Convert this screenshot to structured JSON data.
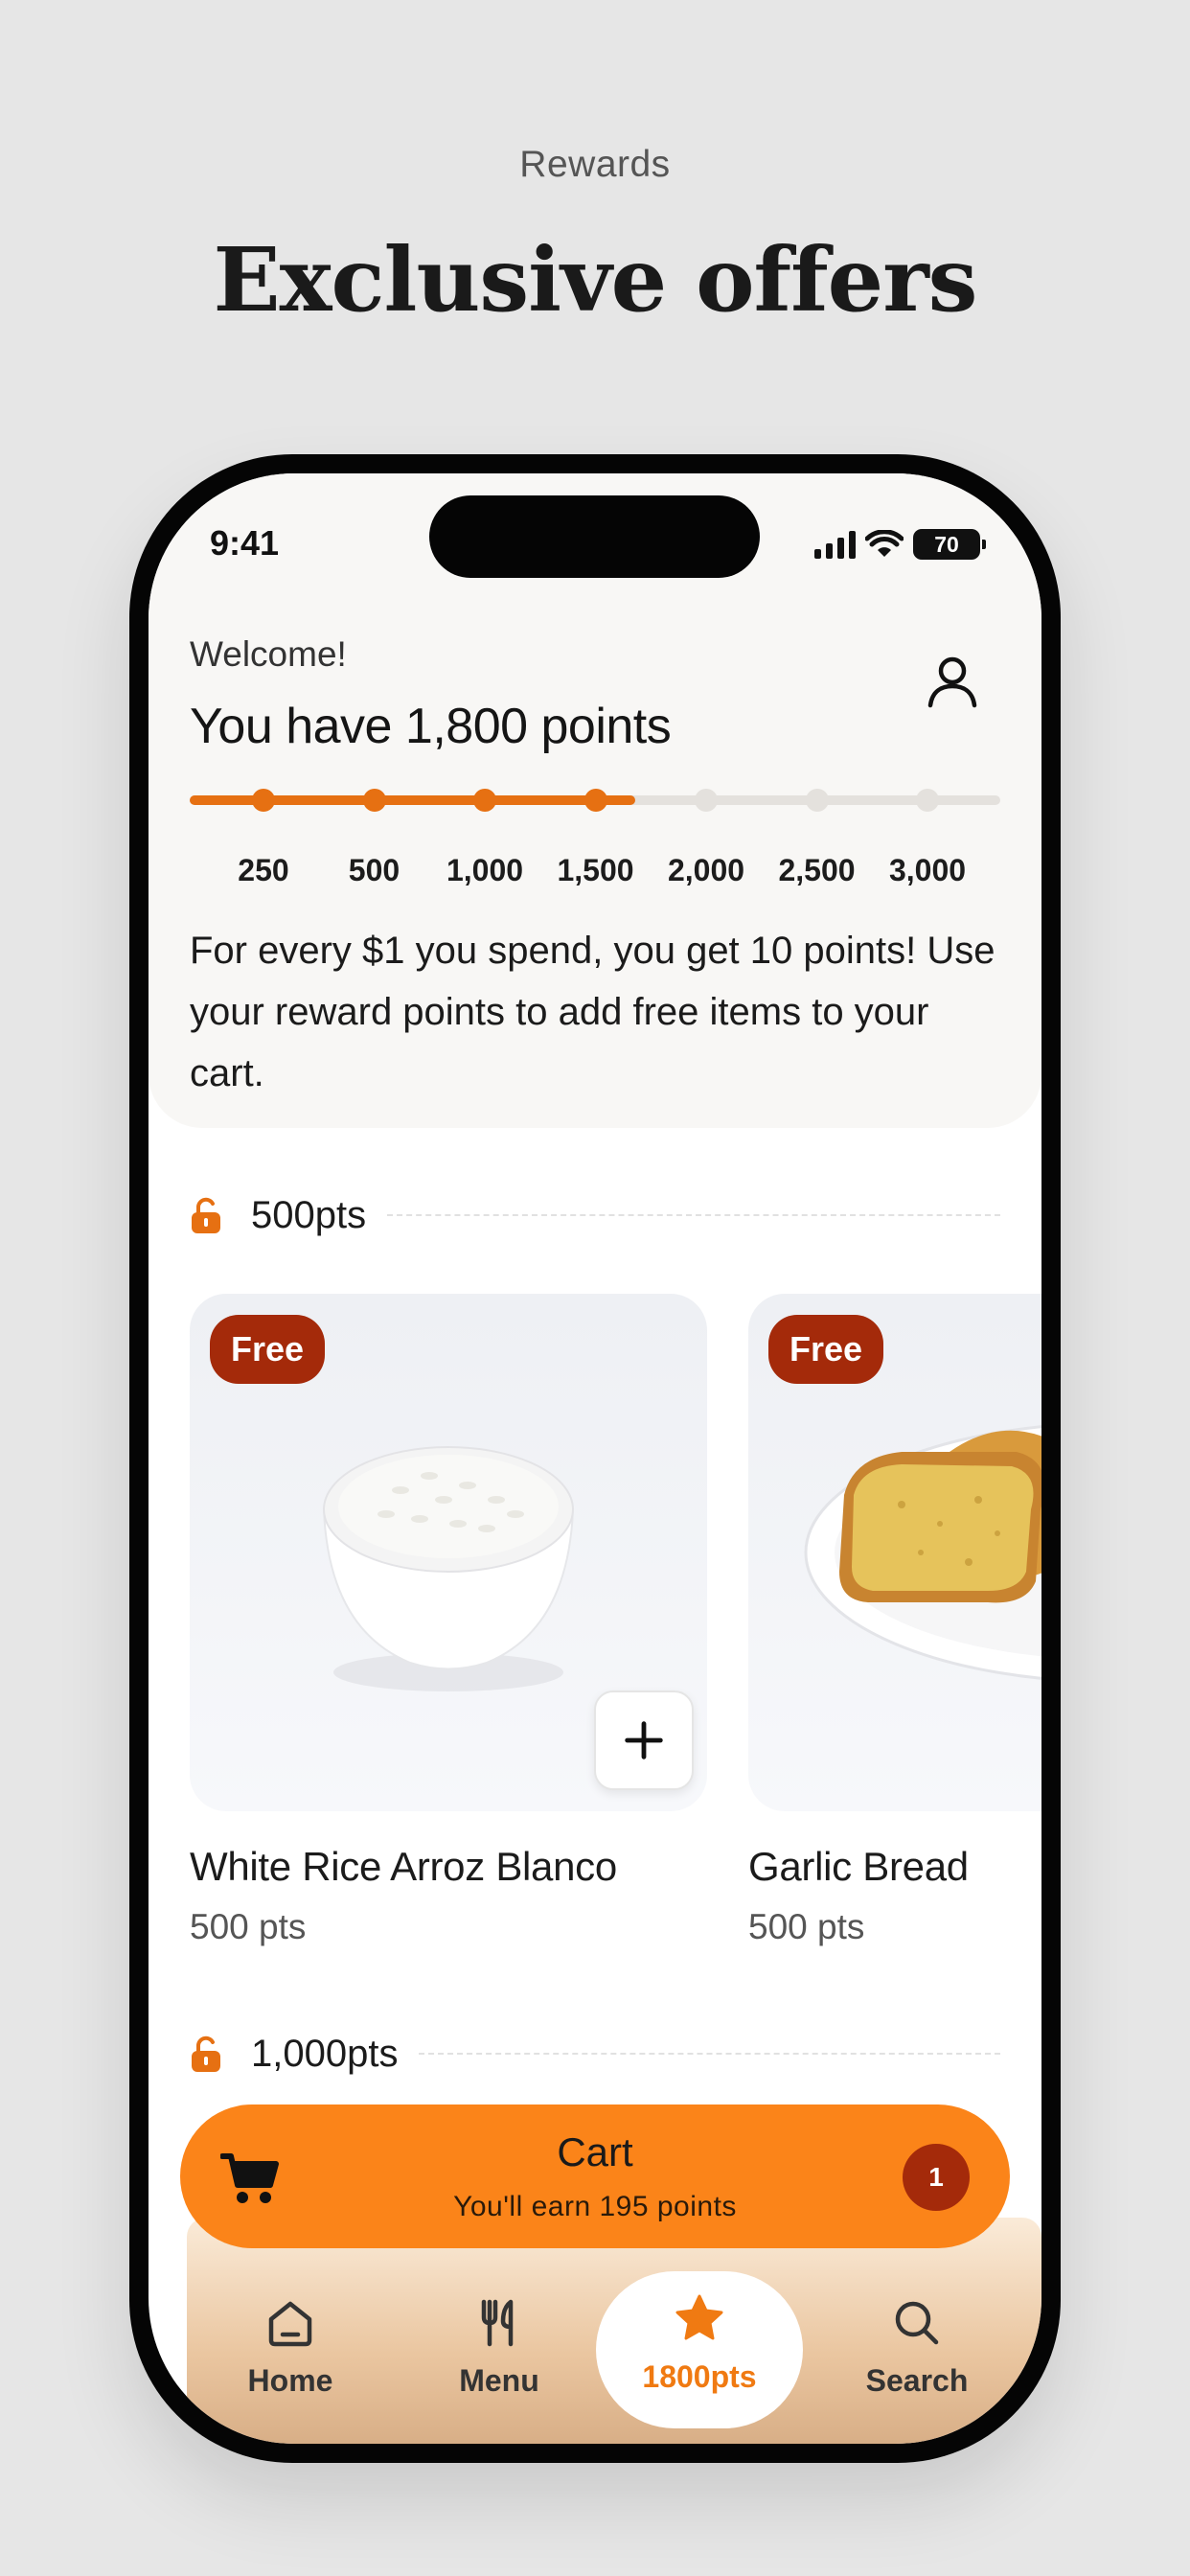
{
  "promo": {
    "eyebrow": "Rewards",
    "title": "Exclusive offers"
  },
  "status_bar": {
    "time": "9:41",
    "battery": "70"
  },
  "header": {
    "welcome": "Welcome!",
    "points_headline": "You have 1,800 points",
    "current_points": 1800,
    "profile_icon": "user-icon"
  },
  "progress": {
    "milestones": [
      "250",
      "500",
      "1,000",
      "1,500",
      "2,000",
      "2,500",
      "3,000"
    ],
    "reached_count": 4,
    "fill_fraction": 0.55
  },
  "info": {
    "text": "For every $1 you spend, you get 10 points! Use your reward points to add free items to your cart."
  },
  "tiers": [
    {
      "label": "500pts",
      "icon": "unlock-icon",
      "items": [
        {
          "badge": "Free",
          "name": "White Rice Arroz Blanco",
          "points": "500 pts",
          "image": "rice-bowl"
        },
        {
          "badge": "Free",
          "name": "Garlic Bread",
          "points": "500 pts",
          "image": "garlic-bread"
        }
      ]
    },
    {
      "label": "1,000pts",
      "icon": "unlock-icon",
      "items": []
    }
  ],
  "cart": {
    "title": "Cart",
    "subtitle": "You'll earn 195 points",
    "count": "1"
  },
  "tabbar": {
    "tabs": [
      {
        "label": "Home",
        "icon": "home-icon"
      },
      {
        "label": "Menu",
        "icon": "utensils-icon"
      },
      {
        "label": "1800pts",
        "icon": "star-icon",
        "active": true
      },
      {
        "label": "Search",
        "icon": "search-icon"
      }
    ]
  },
  "colors": {
    "accent": "#e67012",
    "cart": "#fb8419",
    "badge": "#a42a0a",
    "background": "#e6e6e6"
  }
}
